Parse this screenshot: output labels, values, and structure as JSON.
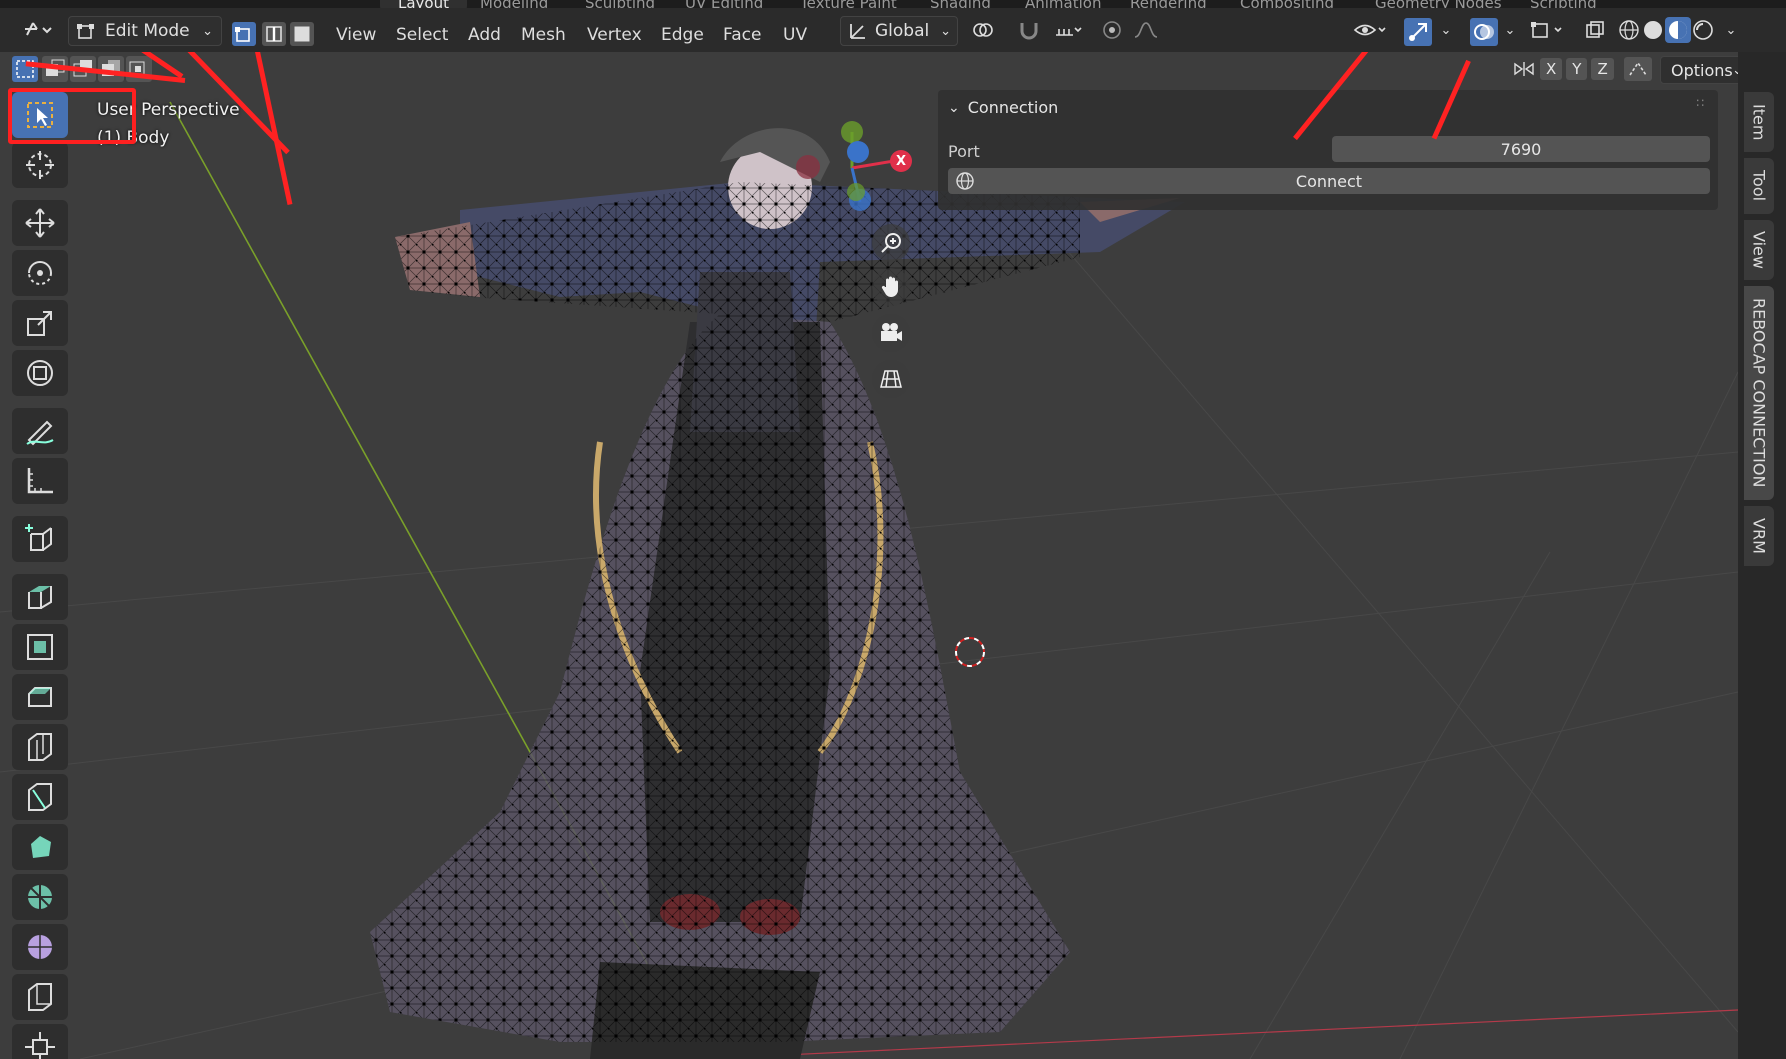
{
  "header": {
    "workspace_tabs": [
      "Layout",
      "Modeling",
      "Sculpting",
      "UV Editing",
      "Texture Paint",
      "Shading",
      "Animation",
      "Rendering",
      "Compositing",
      "Geometry Nodes",
      "Scripting"
    ],
    "mode": "Edit Mode",
    "menus": [
      "View",
      "Select",
      "Add",
      "Mesh",
      "Vertex",
      "Edge",
      "Face",
      "UV"
    ],
    "transform_orientation": "Global",
    "options_label": "Options",
    "axis_x": "X",
    "axis_y": "Y",
    "axis_z": "Z"
  },
  "viewport": {
    "view_name": "User Perspective",
    "object_name": "(1) Body",
    "gizmo_x": "X"
  },
  "panel": {
    "title": "Connection",
    "port_label": "Port",
    "port_value": "7690",
    "connect_label": "Connect"
  },
  "sidebar": {
    "tabs": [
      "Item",
      "Tool",
      "View",
      "REBOCAP CONNECTION",
      "VRM"
    ]
  },
  "colors": {
    "accent": "#4772b3",
    "annotation": "#ff2020",
    "axis_x": "#e0304a",
    "axis_y": "#6a9e2b",
    "axis_z": "#3a73c9"
  }
}
